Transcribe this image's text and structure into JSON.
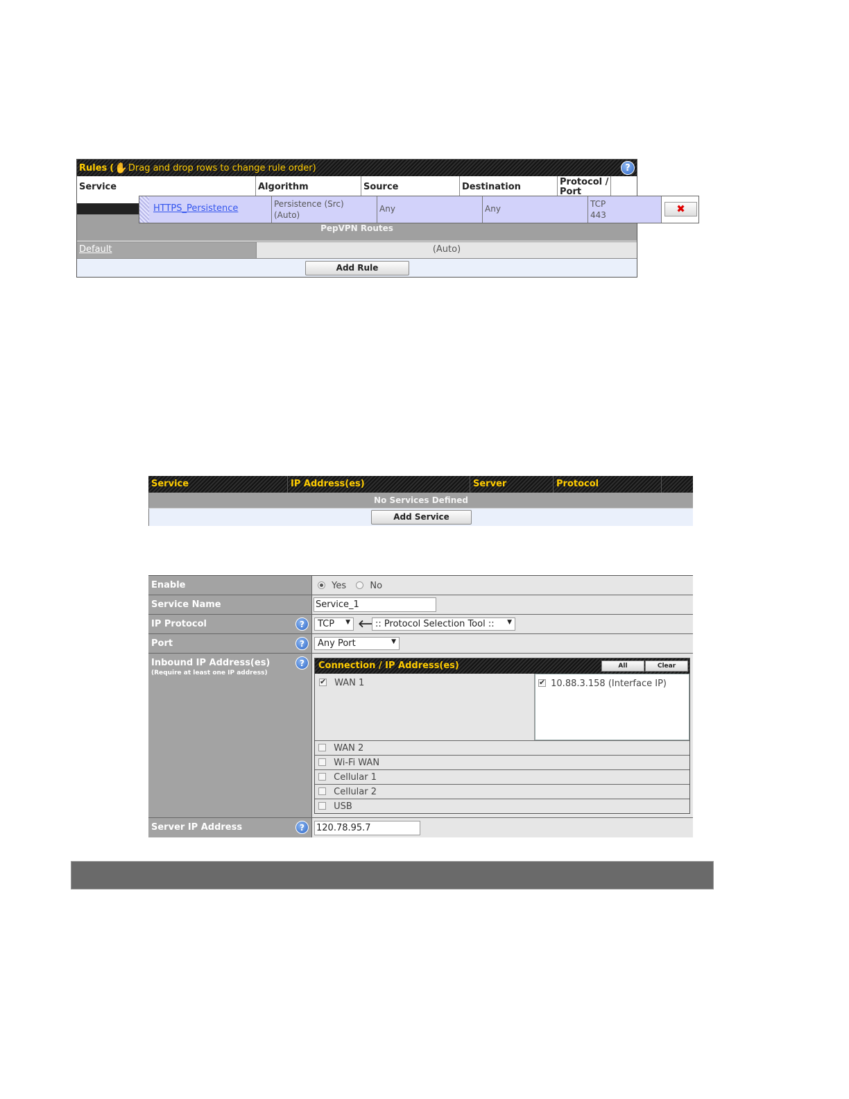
{
  "rules": {
    "title": "Rules",
    "hint": "Drag and drop rows to change rule order)",
    "open_paren": "(",
    "help_glyph": "?",
    "columns": [
      "Service",
      "Algorithm",
      "Source",
      "Destination",
      "Protocol / Port"
    ],
    "dragged_row": {
      "service": "HTTPS_Persistence",
      "algorithm_line1": "Persistence (Src)",
      "algorithm_line2": "(Auto)",
      "source": "Any",
      "destination": "Any",
      "protocol_line1": "TCP",
      "protocol_line2": "443",
      "delete_glyph": "✖"
    },
    "pepvpn_label": "PepVPN Routes",
    "default_label": "Default",
    "default_value": "(Auto)",
    "add_rule_label": "Add Rule"
  },
  "services": {
    "columns": [
      "Service",
      "IP Address(es)",
      "Server",
      "Protocol"
    ],
    "empty_label": "No Services Defined",
    "add_service_label": "Add Service"
  },
  "form": {
    "enable": {
      "label": "Enable",
      "yes": "Yes",
      "no": "No",
      "selected": "Yes"
    },
    "service_name": {
      "label": "Service Name",
      "value": "Service_1"
    },
    "ip_protocol": {
      "label": "IP Protocol",
      "value": "TCP",
      "arrow": "🡐",
      "tool": ":: Protocol Selection Tool ::"
    },
    "port": {
      "label": "Port",
      "value": "Any Port"
    },
    "inbound": {
      "label": "Inbound IP Address(es)",
      "note": "(Require at least one IP address)",
      "header": "Connection / IP Address(es)",
      "all_label": "All",
      "clear_label": "Clear",
      "wan1": "WAN 1",
      "wan1_ip": "10.88.3.158 (Interface IP)",
      "others": [
        "WAN 2",
        "Wi-Fi WAN",
        "Cellular 1",
        "Cellular 2",
        "USB"
      ]
    },
    "server_ip": {
      "label": "Server IP Address",
      "value": "120.78.95.7"
    }
  },
  "colors": {
    "header_text": "#ffcc00",
    "dragged_row_bg": "#d2d2fa",
    "label_bg": "#a3a3a3",
    "footer_bar": "#6a6a6a"
  }
}
